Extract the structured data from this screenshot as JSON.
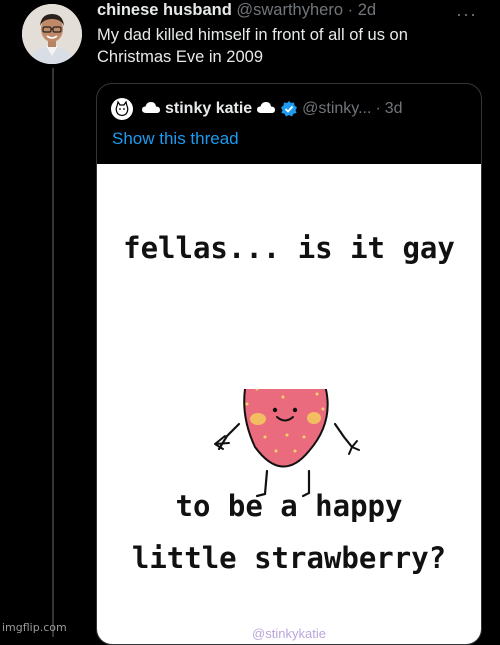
{
  "tweet": {
    "author_name": "chinese husband",
    "handle": "@swarthyhero",
    "separator": "·",
    "time": "2d",
    "text_line1": "My dad killed himself in front of all of us on",
    "text_line2": "Christmas Eve in 2009",
    "more_icon": "more-horizontal-icon"
  },
  "quote": {
    "author_name": "stinky katie",
    "handle": "@stinky...",
    "separator": "·",
    "time": "3d",
    "show_thread_label": "Show this thread",
    "verified_color": "#1d9bf0",
    "image": {
      "line1": "fellas... is it gay",
      "line2": "to be a happy",
      "line3": "little strawberry?",
      "watermark": "@stinkykatie"
    }
  },
  "colors": {
    "link": "#1d9bf0",
    "secondary_text": "#71767b",
    "background": "#000000"
  },
  "imgflip_watermark": "imgflip.com"
}
